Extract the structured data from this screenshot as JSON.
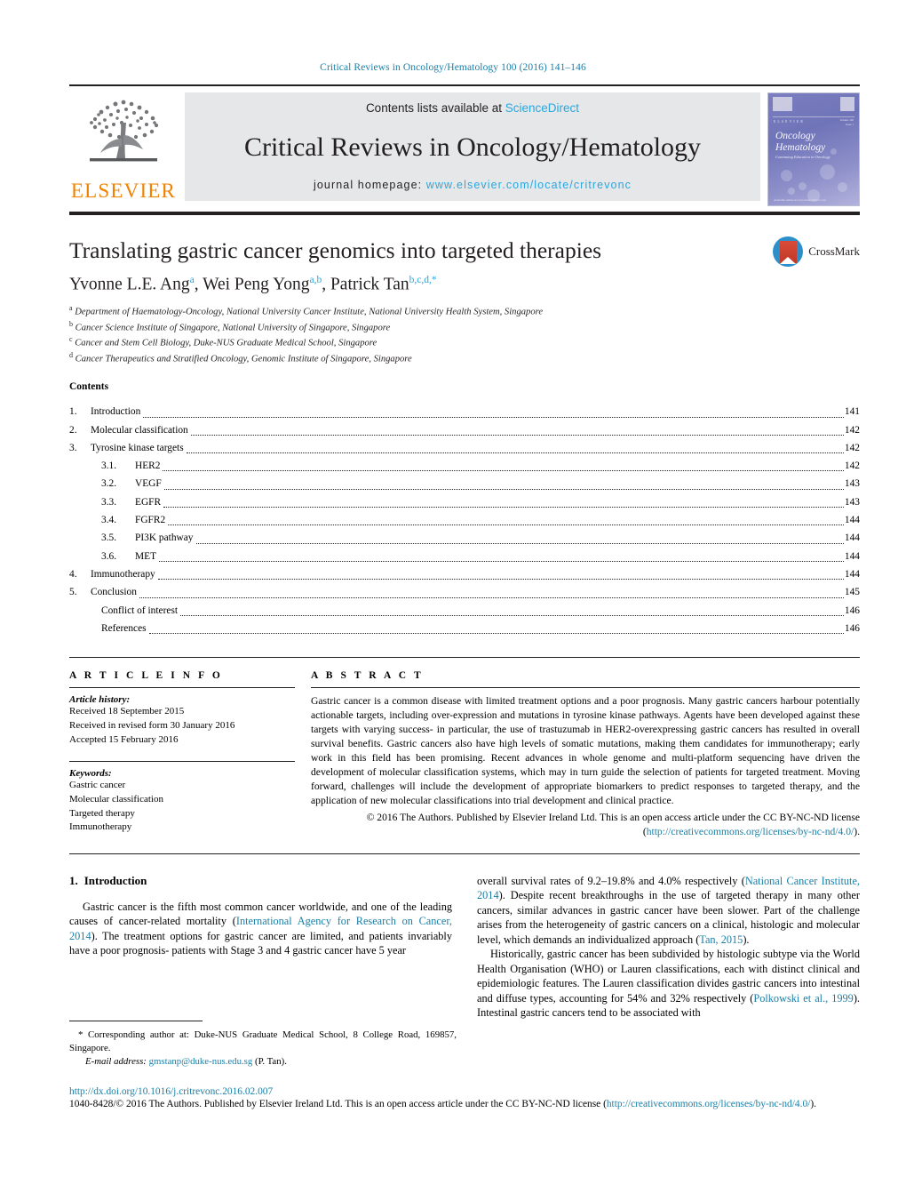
{
  "running_head": "Critical Reviews in Oncology/Hematology 100 (2016) 141–146",
  "masthead": {
    "publisher": "ELSEVIER",
    "contents_prefix": "Contents lists available at ",
    "contents_link": "ScienceDirect",
    "journal_title": "Critical Reviews in Oncology/Hematology",
    "homepage_prefix": "journal homepage: ",
    "homepage_url": "www.elsevier.com/locate/critrevonc",
    "cover": {
      "line1": "Oncology",
      "line2": "Hematology",
      "subtitle": "Continuing Education in Oncology",
      "small_left": "E L S E V I E R",
      "small_right": "Volume 100\nIssue 1\nApril 2016",
      "footer": "Available online at www.sciencedirect.com"
    }
  },
  "crossmark": {
    "label": "CrossMark"
  },
  "article": {
    "title": "Translating gastric cancer genomics into targeted therapies",
    "authors": [
      {
        "name": "Yvonne L.E. Ang",
        "sup": "a"
      },
      {
        "name": "Wei Peng Yong",
        "sup": "a,b"
      },
      {
        "name": "Patrick Tan",
        "sup": "b,c,d,*"
      }
    ],
    "affiliations": [
      {
        "marker": "a",
        "text": "Department of Haematology-Oncology, National University Cancer Institute, National University Health System, Singapore"
      },
      {
        "marker": "b",
        "text": "Cancer Science Institute of Singapore, National University of Singapore, Singapore"
      },
      {
        "marker": "c",
        "text": "Cancer and Stem Cell Biology, Duke-NUS Graduate Medical School, Singapore"
      },
      {
        "marker": "d",
        "text": "Cancer Therapeutics and Stratified Oncology, Genomic Institute of Singapore, Singapore"
      }
    ]
  },
  "contents": {
    "heading": "Contents",
    "entries": [
      {
        "level": 1,
        "num": "1.",
        "label": "Introduction",
        "page": "141"
      },
      {
        "level": 1,
        "num": "2.",
        "label": "Molecular classification",
        "page": "142"
      },
      {
        "level": 1,
        "num": "3.",
        "label": "Tyrosine kinase targets",
        "page": "142"
      },
      {
        "level": 2,
        "num": "3.1.",
        "label": "HER2",
        "page": "142"
      },
      {
        "level": 2,
        "num": "3.2.",
        "label": "VEGF",
        "page": "143"
      },
      {
        "level": 2,
        "num": "3.3.",
        "label": "EGFR",
        "page": "143"
      },
      {
        "level": 2,
        "num": "3.4.",
        "label": "FGFR2",
        "page": "144"
      },
      {
        "level": 2,
        "num": "3.5.",
        "label": "PI3K pathway",
        "page": "144"
      },
      {
        "level": 2,
        "num": "3.6.",
        "label": "MET",
        "page": "144"
      },
      {
        "level": 1,
        "num": "4.",
        "label": "Immunotherapy",
        "page": "144"
      },
      {
        "level": 1,
        "num": "5.",
        "label": "Conclusion",
        "page": "145"
      },
      {
        "level": 1,
        "num": "",
        "label": "Conflict of interest",
        "page": "146"
      },
      {
        "level": 1,
        "num": "",
        "label": "References",
        "page": "146"
      }
    ]
  },
  "article_info": {
    "heading": "A R T I C L E   I N F O",
    "history_label": "Article history:",
    "history": [
      "Received 18 September 2015",
      "Received in revised form 30 January 2016",
      "Accepted 15 February 2016"
    ],
    "keywords_label": "Keywords:",
    "keywords": [
      "Gastric cancer",
      "Molecular classification",
      "Targeted therapy",
      "Immunotherapy"
    ]
  },
  "abstract": {
    "heading": "A B S T R A C T",
    "body": "Gastric cancer is a common disease with limited treatment options and a poor prognosis. Many gastric cancers harbour potentially actionable targets, including over-expression and mutations in tyrosine kinase pathways. Agents have been developed against these targets with varying success- in particular, the use of trastuzumab in HER2-overexpressing gastric cancers has resulted in overall survival benefits. Gastric cancers also have high levels of somatic mutations, making them candidates for immunotherapy; early work in this field has been promising. Recent advances in whole genome and multi-platform sequencing have driven the development of molecular classification systems, which may in turn guide the selection of patients for targeted treatment. Moving forward, challenges will include the development of appropriate biomarkers to predict responses to targeted therapy, and the application of new molecular classifications into trial development and clinical practice.",
    "copyright_prefix": "© 2016 The Authors. Published by Elsevier Ireland Ltd. This is an open access article under the CC BY-NC-ND license (",
    "copyright_link": "http://creativecommons.org/licenses/by-nc-nd/4.0/",
    "copyright_suffix": ")."
  },
  "introduction": {
    "heading_num": "1.",
    "heading_text": "Introduction",
    "para1_a": "Gastric cancer is the fifth most common cancer worldwide, and one of the leading causes of cancer-related mortality (",
    "para1_cite1": "International Agency for Research on Cancer, 2014",
    "para1_b": "). The treatment options for gastric cancer are limited, and patients invariably have a poor prognosis- patients with Stage 3 and 4 gastric cancer have 5 year overall survival rates of 9.2–19.8% and 4.0% respectively (",
    "para1_cite2": "National Cancer Institute, 2014",
    "para1_c": "). Despite recent breakthroughs in the use of targeted therapy in many other cancers, similar advances in gastric cancer have been slower. Part of the challenge arises from the heterogeneity of gastric cancers on a clinical, histologic and molecular level, which demands an individualized approach (",
    "para1_cite3": "Tan, 2015",
    "para1_d": ").",
    "para2_a": "Historically, gastric cancer has been subdivided by histologic subtype via the World Health Organisation (WHO) or Lauren classifications, each with distinct clinical and epidemiologic features. The Lauren classification divides gastric cancers into intestinal and diffuse types, accounting for 54% and 32% respectively (",
    "para2_cite": "Polkowski et al., 1999",
    "para2_b": "). Intestinal gastric cancers tend to be associated with"
  },
  "footnote": {
    "corresponding": "* Corresponding author at: Duke-NUS Graduate Medical School, 8 College Road, 169857, Singapore.",
    "email_label": "E-mail address:",
    "email": "gmstanp@duke-nus.edu.sg",
    "email_suffix": "(P. Tan)."
  },
  "bottom": {
    "doi": "http://dx.doi.org/10.1016/j.critrevonc.2016.02.007",
    "license_a": "1040-8428/© 2016 The Authors. Published by Elsevier Ireland Ltd. This is an open access article under the CC BY-NC-ND license (",
    "license_link": "http://creativecommons.org/licenses/by-nc-nd/4.0/",
    "license_b": ")."
  },
  "colors": {
    "link": "#1a7fa8",
    "sciencedirect": "#2ba6de",
    "elsevier_orange": "#ef8200",
    "band": "#e6e7e8",
    "text": "#231f20"
  }
}
